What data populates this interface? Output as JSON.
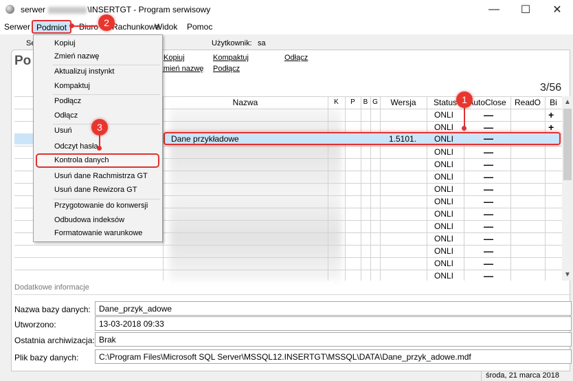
{
  "window": {
    "title_prefix": "serwer",
    "title_suffix": "\\INSERTGT - Program serwisowy",
    "minimize": "—",
    "maximize": "☐",
    "close": "✕"
  },
  "menubar": [
    "Serwer",
    "Podmiot",
    "Biuro",
    "Rachunkowe",
    "Widok",
    "Pomoc"
  ],
  "tabs": {
    "first": "Se",
    "user_label": "Użytkownik:",
    "user_value": "sa"
  },
  "section_heading": "Po",
  "links": [
    "Kopiuj",
    "Zmień nazwę",
    "Kompaktuj",
    "Podłącz",
    "Odłącz"
  ],
  "counter": "3/56",
  "grid": {
    "headers": [
      "Nazwa",
      "K",
      "P",
      "B",
      "G",
      "Wersja",
      "Status",
      "AutoClose",
      "ReadO",
      "Bi"
    ],
    "selected": {
      "name": "Dane przykładowe",
      "version": "1.5101.",
      "status": "ONLI",
      "autoclose": "—"
    },
    "status_values": [
      "ONLI",
      "ONLI",
      "ONLI",
      "ONLI",
      "ONLI",
      "ONLI",
      "ONLI",
      "ONLI",
      "ONLI",
      "ONLI",
      "ONLI",
      "ONLI",
      "ONLI",
      "ONLI"
    ],
    "autoclose_values": [
      "—",
      "—",
      "—",
      "—",
      "—",
      "—",
      "—",
      "—",
      "—",
      "—",
      "—",
      "—",
      "—",
      "—"
    ],
    "bi_values": [
      "+",
      "+"
    ]
  },
  "dropdown": {
    "items": [
      "Kopiuj",
      "Zmień nazwę",
      "Aktualizuj instynkt",
      "Kompaktuj",
      "Podłącz",
      "Odłącz",
      "Usuń",
      "Odczyt hasła",
      "Kontrola danych",
      "Usuń dane Rachmistrza GT",
      "Usuń dane Rewizora GT",
      "Przygotowanie do konwersji",
      "Odbudowa indeksów",
      "Formatowanie warunkowe"
    ]
  },
  "callouts": [
    "1",
    "2",
    "3"
  ],
  "extra": {
    "title": "Dodatkowe informacje",
    "fields": [
      {
        "label": "Nazwa bazy danych:",
        "value": "Dane_przyk_adowe"
      },
      {
        "label": "Utworzono:",
        "value": "13-03-2018 09:33"
      },
      {
        "label": "Ostatnia archiwizacja:",
        "value": "Brak"
      },
      {
        "label": "Plik bazy danych:",
        "value": "C:\\Program Files\\Microsoft SQL Server\\MSSQL12.INSERTGT\\MSSQL\\DATA\\Dane_przyk_adowe.mdf"
      }
    ]
  },
  "status_bar": "środa, 21 marca 2018",
  "colors": {
    "highlight_red": "#e03131",
    "selection_blue": "#cce4f7",
    "badge_red": "#e8362f"
  }
}
